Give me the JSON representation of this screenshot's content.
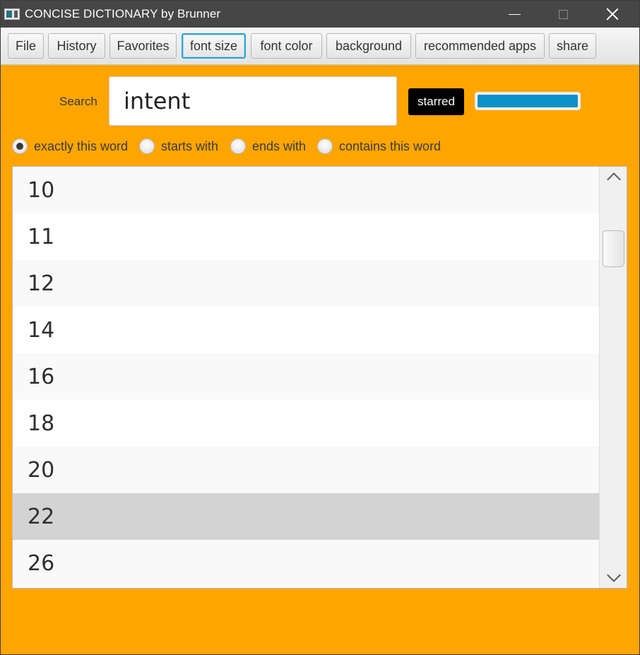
{
  "window": {
    "title": "CONCISE DICTIONARY by Brunner",
    "controls": {
      "minimize": "minimize",
      "maximize": "maximize",
      "close": "close"
    }
  },
  "toolbar": {
    "buttons": [
      {
        "label": "File"
      },
      {
        "label": "History"
      },
      {
        "label": "Favorites"
      },
      {
        "label": "font size",
        "focused": true
      },
      {
        "label": "font color"
      },
      {
        "label": "background"
      },
      {
        "label": "recommended apps"
      },
      {
        "label": "share"
      }
    ]
  },
  "search": {
    "label": "Search",
    "value": "intent",
    "starred_label": "starred",
    "progress": 1.0
  },
  "match_modes": {
    "options": [
      {
        "label": "exactly this word",
        "checked": true
      },
      {
        "label": "starts with",
        "checked": false
      },
      {
        "label": "ends with",
        "checked": false
      },
      {
        "label": "contains this word",
        "checked": false
      }
    ]
  },
  "font_size_list": {
    "items": [
      "10",
      "11",
      "12",
      "14",
      "16",
      "18",
      "20",
      "22",
      "26"
    ],
    "selected": "22"
  },
  "colors": {
    "background": "#ffa500",
    "titlebar": "#464646",
    "focus": "#2fa3d4",
    "progress": "#0b90c8",
    "selected_row": "#d3d3d3"
  },
  "icons": {
    "app": "dictionary-app-icon",
    "scroll_up": "chevron-up-icon",
    "scroll_down": "chevron-down-icon"
  }
}
